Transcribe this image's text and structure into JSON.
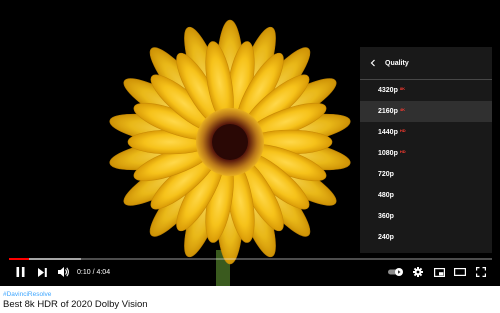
{
  "video": {
    "hashtag": "#DavinciResolve",
    "title": "Best 8k HDR of 2020 Dolby Vision",
    "progress_fraction": 0.041,
    "buffered_fraction": 0.15
  },
  "player": {
    "time_current": "0:10",
    "time_separator": " / ",
    "time_total": "4:04",
    "autoplay_toggle_on": true
  },
  "quality_menu": {
    "title": "Quality",
    "options": [
      {
        "label": "4320p",
        "badge": "8K",
        "selected": false
      },
      {
        "label": "2160p",
        "badge": "4K",
        "selected": true
      },
      {
        "label": "1440p",
        "badge": "HD",
        "selected": false
      },
      {
        "label": "1080p",
        "badge": "HD",
        "selected": false
      },
      {
        "label": "720p",
        "badge": "",
        "selected": false
      },
      {
        "label": "480p",
        "badge": "",
        "selected": false
      },
      {
        "label": "360p",
        "badge": "",
        "selected": false
      },
      {
        "label": "240p",
        "badge": "",
        "selected": false
      }
    ]
  },
  "colors": {
    "progress": "#ff0000",
    "hashtag": "#3ea6ff",
    "badge": "#ff3b30",
    "petal": "#f6c21a"
  },
  "icons": {
    "back": "chevron-left-icon",
    "play_pause": "pause-icon",
    "next": "skip-next-icon",
    "volume": "volume-icon",
    "autoplay": "autoplay-toggle-icon",
    "settings": "gear-icon",
    "miniplayer": "miniplayer-icon",
    "theater": "theater-mode-icon",
    "fullscreen": "fullscreen-icon"
  }
}
